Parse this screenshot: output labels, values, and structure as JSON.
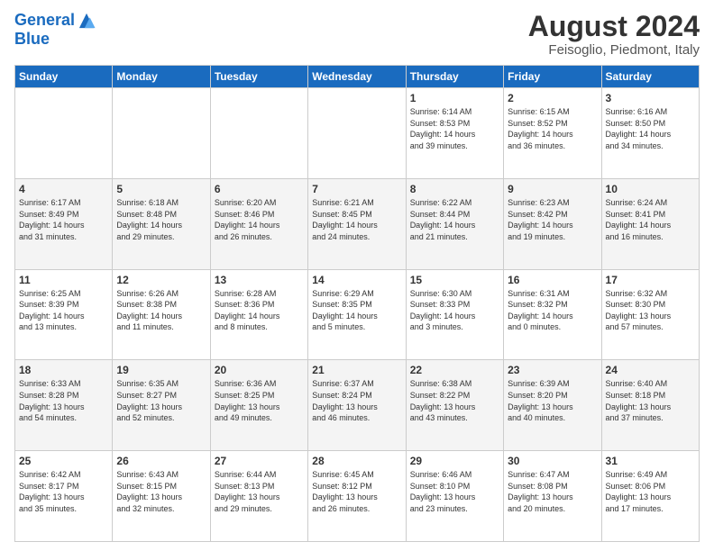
{
  "logo": {
    "line1": "General",
    "line2": "Blue"
  },
  "title": {
    "month_year": "August 2024",
    "location": "Feisoglio, Piedmont, Italy"
  },
  "header_days": [
    "Sunday",
    "Monday",
    "Tuesday",
    "Wednesday",
    "Thursday",
    "Friday",
    "Saturday"
  ],
  "weeks": [
    [
      {
        "day": "",
        "info": ""
      },
      {
        "day": "",
        "info": ""
      },
      {
        "day": "",
        "info": ""
      },
      {
        "day": "",
        "info": ""
      },
      {
        "day": "1",
        "info": "Sunrise: 6:14 AM\nSunset: 8:53 PM\nDaylight: 14 hours\nand 39 minutes."
      },
      {
        "day": "2",
        "info": "Sunrise: 6:15 AM\nSunset: 8:52 PM\nDaylight: 14 hours\nand 36 minutes."
      },
      {
        "day": "3",
        "info": "Sunrise: 6:16 AM\nSunset: 8:50 PM\nDaylight: 14 hours\nand 34 minutes."
      }
    ],
    [
      {
        "day": "4",
        "info": "Sunrise: 6:17 AM\nSunset: 8:49 PM\nDaylight: 14 hours\nand 31 minutes."
      },
      {
        "day": "5",
        "info": "Sunrise: 6:18 AM\nSunset: 8:48 PM\nDaylight: 14 hours\nand 29 minutes."
      },
      {
        "day": "6",
        "info": "Sunrise: 6:20 AM\nSunset: 8:46 PM\nDaylight: 14 hours\nand 26 minutes."
      },
      {
        "day": "7",
        "info": "Sunrise: 6:21 AM\nSunset: 8:45 PM\nDaylight: 14 hours\nand 24 minutes."
      },
      {
        "day": "8",
        "info": "Sunrise: 6:22 AM\nSunset: 8:44 PM\nDaylight: 14 hours\nand 21 minutes."
      },
      {
        "day": "9",
        "info": "Sunrise: 6:23 AM\nSunset: 8:42 PM\nDaylight: 14 hours\nand 19 minutes."
      },
      {
        "day": "10",
        "info": "Sunrise: 6:24 AM\nSunset: 8:41 PM\nDaylight: 14 hours\nand 16 minutes."
      }
    ],
    [
      {
        "day": "11",
        "info": "Sunrise: 6:25 AM\nSunset: 8:39 PM\nDaylight: 14 hours\nand 13 minutes."
      },
      {
        "day": "12",
        "info": "Sunrise: 6:26 AM\nSunset: 8:38 PM\nDaylight: 14 hours\nand 11 minutes."
      },
      {
        "day": "13",
        "info": "Sunrise: 6:28 AM\nSunset: 8:36 PM\nDaylight: 14 hours\nand 8 minutes."
      },
      {
        "day": "14",
        "info": "Sunrise: 6:29 AM\nSunset: 8:35 PM\nDaylight: 14 hours\nand 5 minutes."
      },
      {
        "day": "15",
        "info": "Sunrise: 6:30 AM\nSunset: 8:33 PM\nDaylight: 14 hours\nand 3 minutes."
      },
      {
        "day": "16",
        "info": "Sunrise: 6:31 AM\nSunset: 8:32 PM\nDaylight: 14 hours\nand 0 minutes."
      },
      {
        "day": "17",
        "info": "Sunrise: 6:32 AM\nSunset: 8:30 PM\nDaylight: 13 hours\nand 57 minutes."
      }
    ],
    [
      {
        "day": "18",
        "info": "Sunrise: 6:33 AM\nSunset: 8:28 PM\nDaylight: 13 hours\nand 54 minutes."
      },
      {
        "day": "19",
        "info": "Sunrise: 6:35 AM\nSunset: 8:27 PM\nDaylight: 13 hours\nand 52 minutes."
      },
      {
        "day": "20",
        "info": "Sunrise: 6:36 AM\nSunset: 8:25 PM\nDaylight: 13 hours\nand 49 minutes."
      },
      {
        "day": "21",
        "info": "Sunrise: 6:37 AM\nSunset: 8:24 PM\nDaylight: 13 hours\nand 46 minutes."
      },
      {
        "day": "22",
        "info": "Sunrise: 6:38 AM\nSunset: 8:22 PM\nDaylight: 13 hours\nand 43 minutes."
      },
      {
        "day": "23",
        "info": "Sunrise: 6:39 AM\nSunset: 8:20 PM\nDaylight: 13 hours\nand 40 minutes."
      },
      {
        "day": "24",
        "info": "Sunrise: 6:40 AM\nSunset: 8:18 PM\nDaylight: 13 hours\nand 37 minutes."
      }
    ],
    [
      {
        "day": "25",
        "info": "Sunrise: 6:42 AM\nSunset: 8:17 PM\nDaylight: 13 hours\nand 35 minutes."
      },
      {
        "day": "26",
        "info": "Sunrise: 6:43 AM\nSunset: 8:15 PM\nDaylight: 13 hours\nand 32 minutes."
      },
      {
        "day": "27",
        "info": "Sunrise: 6:44 AM\nSunset: 8:13 PM\nDaylight: 13 hours\nand 29 minutes."
      },
      {
        "day": "28",
        "info": "Sunrise: 6:45 AM\nSunset: 8:12 PM\nDaylight: 13 hours\nand 26 minutes."
      },
      {
        "day": "29",
        "info": "Sunrise: 6:46 AM\nSunset: 8:10 PM\nDaylight: 13 hours\nand 23 minutes."
      },
      {
        "day": "30",
        "info": "Sunrise: 6:47 AM\nSunset: 8:08 PM\nDaylight: 13 hours\nand 20 minutes."
      },
      {
        "day": "31",
        "info": "Sunrise: 6:49 AM\nSunset: 8:06 PM\nDaylight: 13 hours\nand 17 minutes."
      }
    ]
  ]
}
